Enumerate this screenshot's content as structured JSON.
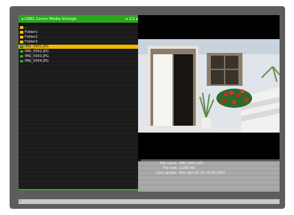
{
  "header": {
    "title": "USB1 Canon Media Storage",
    "page": "1/1",
    "prev_icon": "arrow-left-icon",
    "next_icon": "arrow-right-icon"
  },
  "files": [
    {
      "type": "folder-up",
      "name": ".."
    },
    {
      "type": "folder",
      "name": "Folder1"
    },
    {
      "type": "folder",
      "name": "Folder2"
    },
    {
      "type": "folder",
      "name": "Folder3"
    },
    {
      "type": "image",
      "name": "IMG_0001.JPG",
      "selected": true
    },
    {
      "type": "image",
      "name": "IMG_0002.JPG"
    },
    {
      "type": "image",
      "name": "IMG_0003.JPG"
    },
    {
      "type": "image",
      "name": "IMG_0004.JPG"
    }
  ],
  "info": {
    "file_name_label": "File name",
    "file_name": "IMG_0001.JPG",
    "file_size_label": "File size",
    "file_size": "2,090 KB",
    "last_update_label": "Last update",
    "last_update": "Mon Apr 02 20:14:56 2007"
  },
  "status": {
    "path": "/"
  },
  "colors": {
    "accent": "#2aa81c",
    "selection": "#f2b800"
  }
}
